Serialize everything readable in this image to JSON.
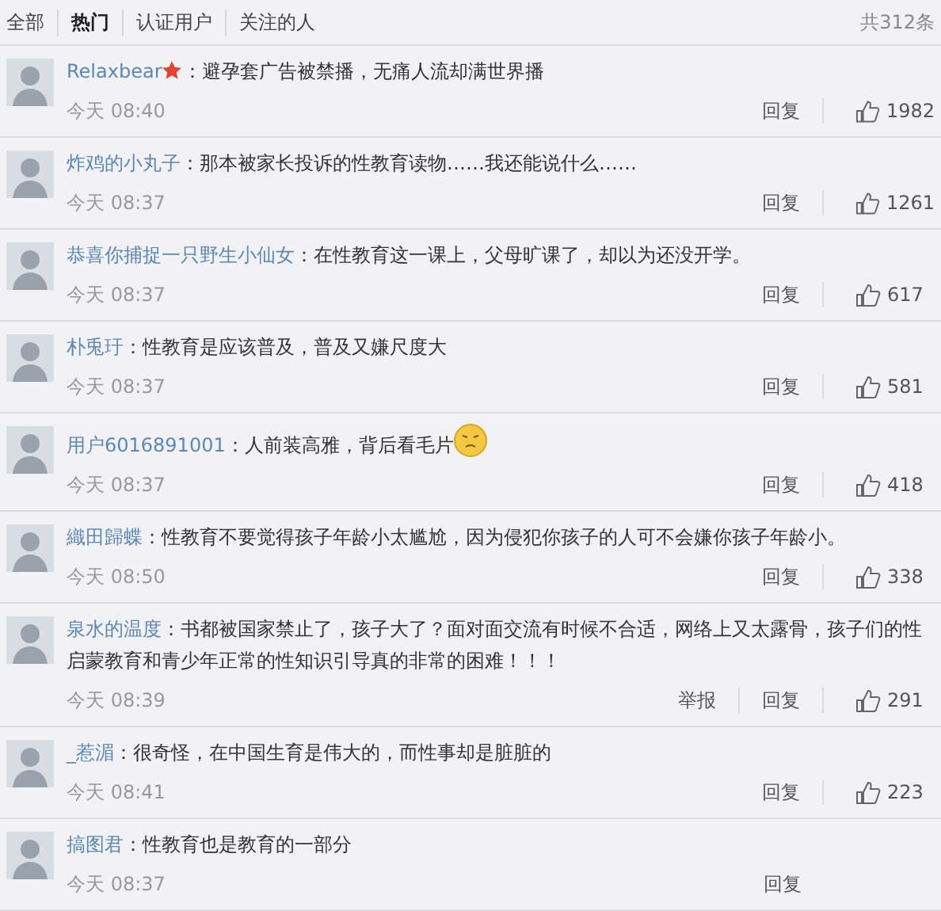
{
  "tabs": [
    {
      "label": "全部",
      "selected": false
    },
    {
      "label": "热门",
      "selected": true
    },
    {
      "label": "认证用户",
      "selected": false
    },
    {
      "label": "关注的人",
      "selected": false
    }
  ],
  "total": "共312条",
  "comments": [
    {
      "name": "Relaxbear",
      "verified": true,
      "text": "：避孕套广告被禁播，无痛人流却满世界播",
      "emoji": false,
      "time": "今天 08:40",
      "actions": [
        "回复"
      ],
      "likes": "1982"
    },
    {
      "name": "炸鸡的小丸子",
      "verified": false,
      "text": "：那本被家长投诉的性教育读物……我还能说什么……",
      "emoji": false,
      "time": "今天 08:37",
      "actions": [
        "回复"
      ],
      "likes": "1261"
    },
    {
      "name": "恭喜你捕捉一只野生小仙女",
      "verified": false,
      "text": "：在性教育这一课上，父母旷课了，却以为还没开学。",
      "emoji": false,
      "time": "今天 08:37",
      "actions": [
        "回复"
      ],
      "likes": "617"
    },
    {
      "name": "朴兎玗",
      "verified": false,
      "text": "：性教育是应该普及，普及又嫌尺度大",
      "emoji": false,
      "time": "今天 08:37",
      "actions": [
        "回复"
      ],
      "likes": "581"
    },
    {
      "name": "用户6016891001",
      "verified": false,
      "text": "：人前装高雅，背后看毛片",
      "emoji": true,
      "time": "今天 08:37",
      "actions": [
        "回复"
      ],
      "likes": "418"
    },
    {
      "name": "織田歸蝶",
      "verified": false,
      "text": "：性教育不要觉得孩子年龄小太尴尬，因为侵犯你孩子的人可不会嫌你孩子年龄小。",
      "emoji": false,
      "time": "今天 08:50",
      "actions": [
        "回复"
      ],
      "likes": "338"
    },
    {
      "name": "泉水的温度",
      "verified": false,
      "text": "：书都被国家禁止了，孩子大了？面对面交流有时候不合适，网络上又太露骨，孩子们的性启蒙教育和青少年正常的性知识引导真的非常的困难！！！",
      "emoji": false,
      "time": "今天 08:39",
      "actions": [
        "举报",
        "回复"
      ],
      "likes": "291"
    },
    {
      "name": "_惹湄",
      "verified": false,
      "text": "：很奇怪，在中国生育是伟大的，而性事却是脏脏的",
      "emoji": false,
      "time": "今天 08:41",
      "actions": [
        "回复"
      ],
      "likes": "223"
    },
    {
      "name": "搞图君",
      "verified": false,
      "text": "：性教育也是教育的一部分",
      "emoji": false,
      "time": "今天 08:37",
      "actions": [
        "回复"
      ]
    }
  ]
}
